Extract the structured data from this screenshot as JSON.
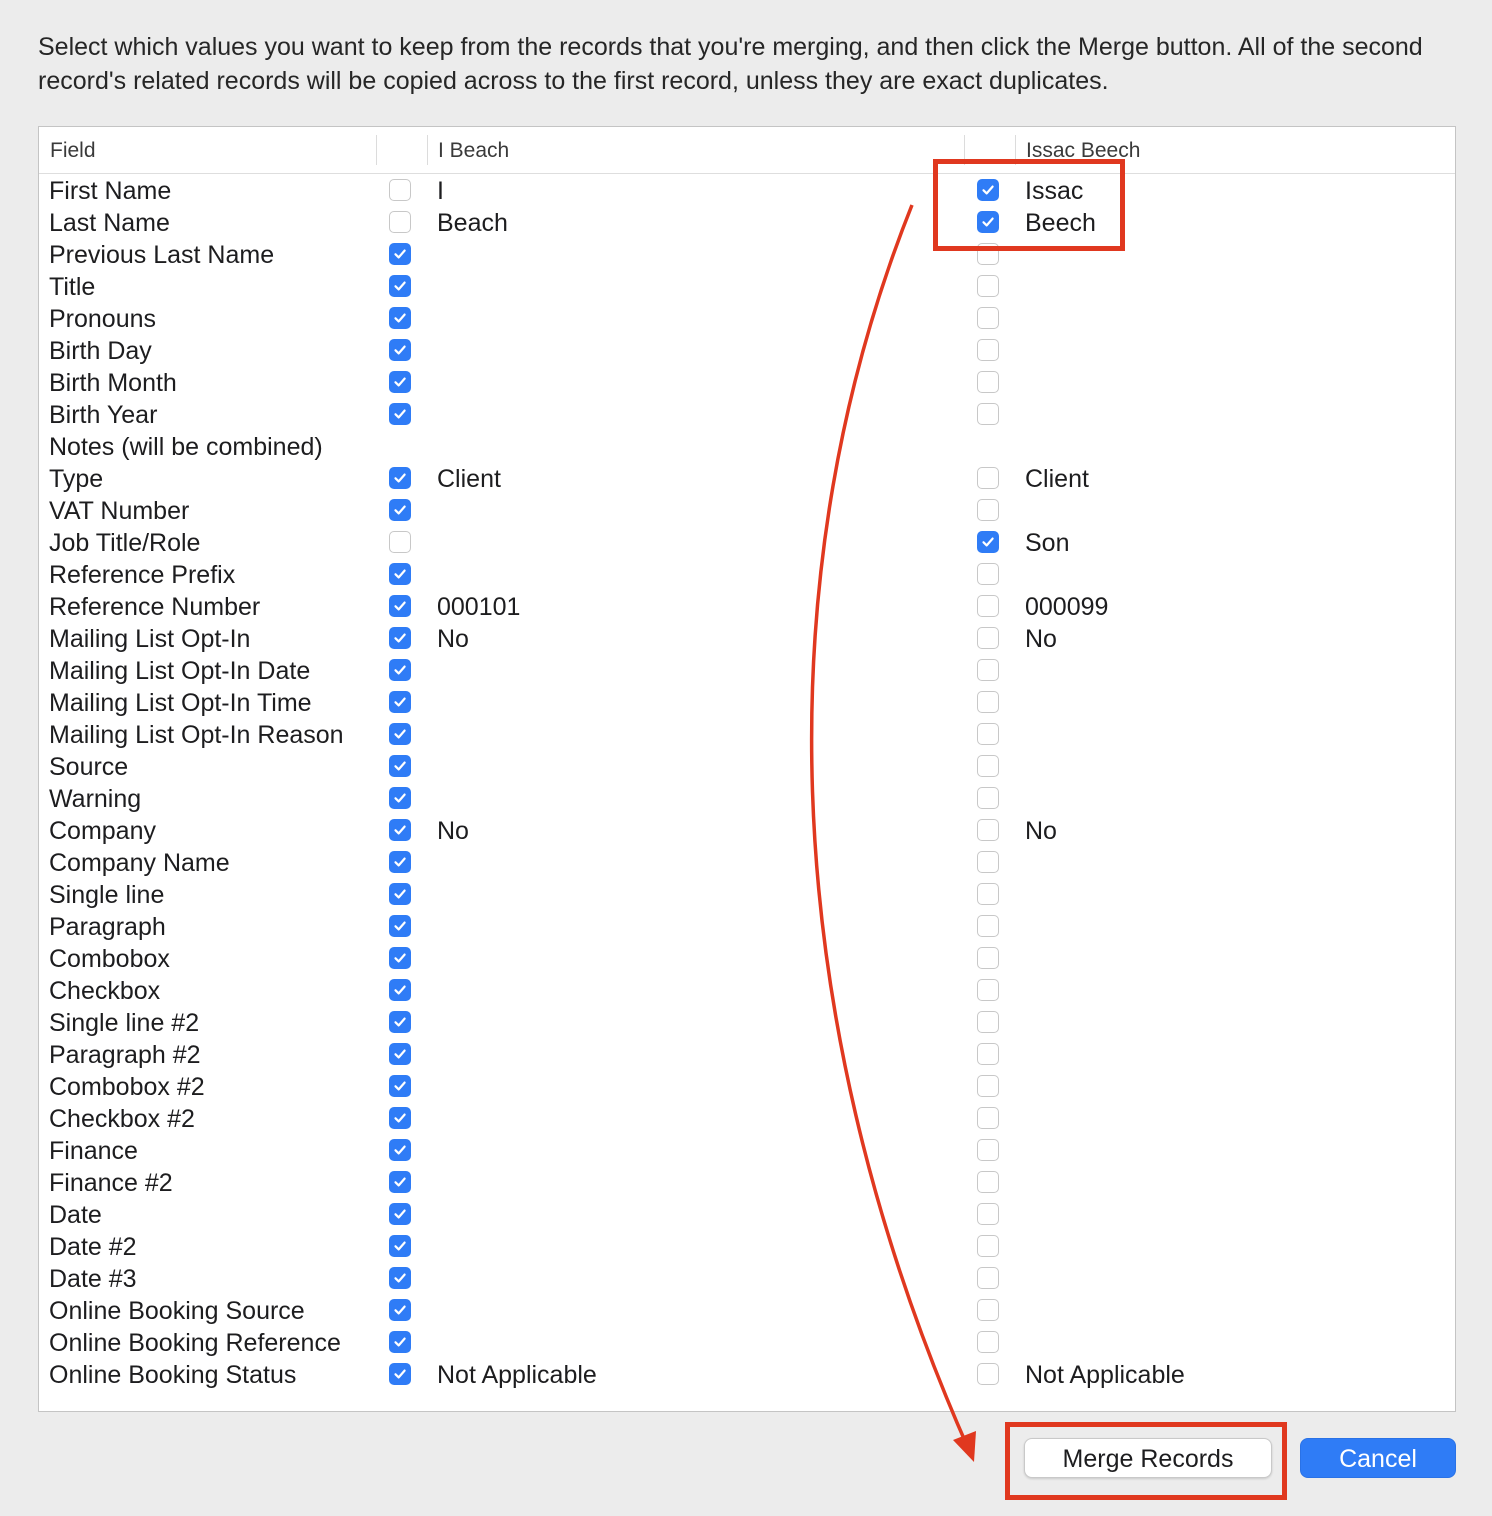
{
  "intro_text": "Select which values you want to keep from the records that you're merging, and then click the Merge button. All of the second record's related records will be copied across to the first record, unless they are exact duplicates.",
  "columns": {
    "field": "Field",
    "record1": "I Beach",
    "record2": "Issac Beech"
  },
  "rows": [
    {
      "field": "First Name",
      "r1_checked": false,
      "r1_value": "I",
      "r2_checked": true,
      "r2_value": "Issac"
    },
    {
      "field": "Last Name",
      "r1_checked": false,
      "r1_value": "Beach",
      "r2_checked": true,
      "r2_value": "Beech"
    },
    {
      "field": "Previous Last Name",
      "r1_checked": true,
      "r1_value": "",
      "r2_checked": false,
      "r2_value": ""
    },
    {
      "field": "Title",
      "r1_checked": true,
      "r1_value": "",
      "r2_checked": false,
      "r2_value": ""
    },
    {
      "field": "Pronouns",
      "r1_checked": true,
      "r1_value": "",
      "r2_checked": false,
      "r2_value": ""
    },
    {
      "field": "Birth Day",
      "r1_checked": true,
      "r1_value": "",
      "r2_checked": false,
      "r2_value": ""
    },
    {
      "field": "Birth Month",
      "r1_checked": true,
      "r1_value": "",
      "r2_checked": false,
      "r2_value": ""
    },
    {
      "field": "Birth Year",
      "r1_checked": true,
      "r1_value": "",
      "r2_checked": false,
      "r2_value": ""
    },
    {
      "field": "Notes (will be combined)",
      "no_checkbox": true,
      "r1_value": "",
      "r2_value": ""
    },
    {
      "field": "Type",
      "r1_checked": true,
      "r1_value": "Client",
      "r2_checked": false,
      "r2_value": "Client"
    },
    {
      "field": "VAT Number",
      "r1_checked": true,
      "r1_value": "",
      "r2_checked": false,
      "r2_value": ""
    },
    {
      "field": "Job Title/Role",
      "r1_checked": false,
      "r1_value": "",
      "r2_checked": true,
      "r2_value": "Son"
    },
    {
      "field": "Reference Prefix",
      "r1_checked": true,
      "r1_value": "",
      "r2_checked": false,
      "r2_value": ""
    },
    {
      "field": "Reference Number",
      "r1_checked": true,
      "r1_value": "000101",
      "r2_checked": false,
      "r2_value": "000099"
    },
    {
      "field": "Mailing List Opt-In",
      "r1_checked": true,
      "r1_value": "No",
      "r2_checked": false,
      "r2_value": "No"
    },
    {
      "field": "Mailing List Opt-In Date",
      "r1_checked": true,
      "r1_value": "",
      "r2_checked": false,
      "r2_value": ""
    },
    {
      "field": "Mailing List Opt-In Time",
      "r1_checked": true,
      "r1_value": "",
      "r2_checked": false,
      "r2_value": ""
    },
    {
      "field": "Mailing List Opt-In Reason",
      "r1_checked": true,
      "r1_value": "",
      "r2_checked": false,
      "r2_value": ""
    },
    {
      "field": "Source",
      "r1_checked": true,
      "r1_value": "",
      "r2_checked": false,
      "r2_value": ""
    },
    {
      "field": "Warning",
      "r1_checked": true,
      "r1_value": "",
      "r2_checked": false,
      "r2_value": ""
    },
    {
      "field": "Company",
      "r1_checked": true,
      "r1_value": "No",
      "r2_checked": false,
      "r2_value": "No"
    },
    {
      "field": "Company Name",
      "r1_checked": true,
      "r1_value": "",
      "r2_checked": false,
      "r2_value": ""
    },
    {
      "field": "Single line",
      "r1_checked": true,
      "r1_value": "",
      "r2_checked": false,
      "r2_value": ""
    },
    {
      "field": "Paragraph",
      "r1_checked": true,
      "r1_value": "",
      "r2_checked": false,
      "r2_value": ""
    },
    {
      "field": "Combobox",
      "r1_checked": true,
      "r1_value": "",
      "r2_checked": false,
      "r2_value": ""
    },
    {
      "field": "Checkbox",
      "r1_checked": true,
      "r1_value": "",
      "r2_checked": false,
      "r2_value": ""
    },
    {
      "field": "Single line #2",
      "r1_checked": true,
      "r1_value": "",
      "r2_checked": false,
      "r2_value": ""
    },
    {
      "field": "Paragraph #2",
      "r1_checked": true,
      "r1_value": "",
      "r2_checked": false,
      "r2_value": ""
    },
    {
      "field": "Combobox #2",
      "r1_checked": true,
      "r1_value": "",
      "r2_checked": false,
      "r2_value": ""
    },
    {
      "field": "Checkbox #2",
      "r1_checked": true,
      "r1_value": "",
      "r2_checked": false,
      "r2_value": ""
    },
    {
      "field": "Finance",
      "r1_checked": true,
      "r1_value": "",
      "r2_checked": false,
      "r2_value": ""
    },
    {
      "field": "Finance #2",
      "r1_checked": true,
      "r1_value": "",
      "r2_checked": false,
      "r2_value": ""
    },
    {
      "field": "Date",
      "r1_checked": true,
      "r1_value": "",
      "r2_checked": false,
      "r2_value": ""
    },
    {
      "field": "Date #2",
      "r1_checked": true,
      "r1_value": "",
      "r2_checked": false,
      "r2_value": ""
    },
    {
      "field": "Date #3",
      "r1_checked": true,
      "r1_value": "",
      "r2_checked": false,
      "r2_value": ""
    },
    {
      "field": "Online Booking Source",
      "r1_checked": true,
      "r1_value": "",
      "r2_checked": false,
      "r2_value": ""
    },
    {
      "field": "Online Booking Reference",
      "r1_checked": true,
      "r1_value": "",
      "r2_checked": false,
      "r2_value": ""
    },
    {
      "field": "Online Booking Status",
      "r1_checked": true,
      "r1_value": "Not Applicable",
      "r2_checked": false,
      "r2_value": "Not Applicable"
    }
  ],
  "buttons": {
    "merge": "Merge Records",
    "cancel": "Cancel"
  },
  "colors": {
    "accent": "#2f7cf6",
    "annotation": "#e0381f",
    "background": "#ececec"
  },
  "icons": {
    "checkbox_checked": "checkmark-icon"
  }
}
